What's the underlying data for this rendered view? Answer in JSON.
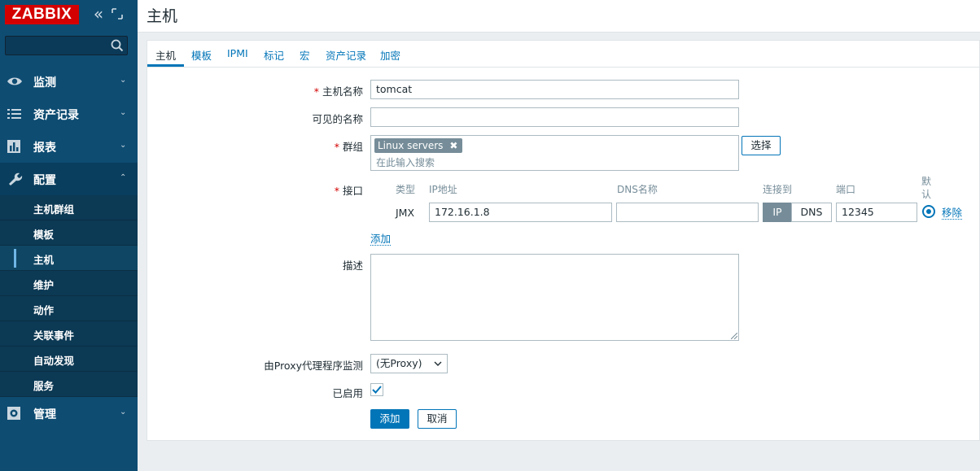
{
  "app": {
    "logo": "ZABBIX",
    "search": {
      "value": "",
      "placeholder": ""
    }
  },
  "sidebar": {
    "menu": [
      {
        "label": "监测",
        "icon": "eye-icon",
        "expanded": false
      },
      {
        "label": "资产记录",
        "icon": "list-icon",
        "expanded": false
      },
      {
        "label": "报表",
        "icon": "bar-chart-icon",
        "expanded": false
      },
      {
        "label": "配置",
        "icon": "wrench-icon",
        "expanded": true
      },
      {
        "label": "管理",
        "icon": "gear-icon",
        "expanded": false
      }
    ],
    "config_submenu": [
      {
        "label": "主机群组"
      },
      {
        "label": "模板"
      },
      {
        "label": "主机",
        "active": true
      },
      {
        "label": "维护"
      },
      {
        "label": "动作"
      },
      {
        "label": "关联事件"
      },
      {
        "label": "自动发现"
      },
      {
        "label": "服务"
      }
    ]
  },
  "header": {
    "title": "主机"
  },
  "tabs": [
    "主机",
    "模板",
    "IPMI",
    "标记",
    "宏",
    "资产记录",
    "加密"
  ],
  "active_tab": "主机",
  "form": {
    "host_name": {
      "label": "主机名称",
      "value": "tomcat",
      "required": true
    },
    "visible_name": {
      "label": "可见的名称",
      "value": ""
    },
    "groups": {
      "label": "群组",
      "required": true,
      "tags": [
        "Linux servers"
      ],
      "placeholder": "在此输入搜索",
      "select_label": "选择"
    },
    "interfaces": {
      "label": "接口",
      "required": true,
      "headers": {
        "type": "类型",
        "ip": "IP地址",
        "dns": "DNS名称",
        "connect_to": "连接到",
        "port": "端口",
        "default": "默认"
      },
      "rows": [
        {
          "type": "JMX",
          "ip": "172.16.1.8",
          "dns": "",
          "connect_ip": "IP",
          "connect_dns": "DNS",
          "connect_selected": "IP",
          "port": "12345",
          "default": true,
          "remove_label": "移除"
        }
      ],
      "add_label": "添加"
    },
    "description": {
      "label": "描述",
      "value": ""
    },
    "proxy": {
      "label": "由Proxy代理程序监测",
      "value": "(无Proxy)"
    },
    "enabled": {
      "label": "已启用",
      "checked": true
    },
    "buttons": {
      "add": "添加",
      "cancel": "取消"
    }
  },
  "colors": {
    "sidebar": "#0e4c72",
    "accent": "#0275b8",
    "logo": "#d40000"
  }
}
